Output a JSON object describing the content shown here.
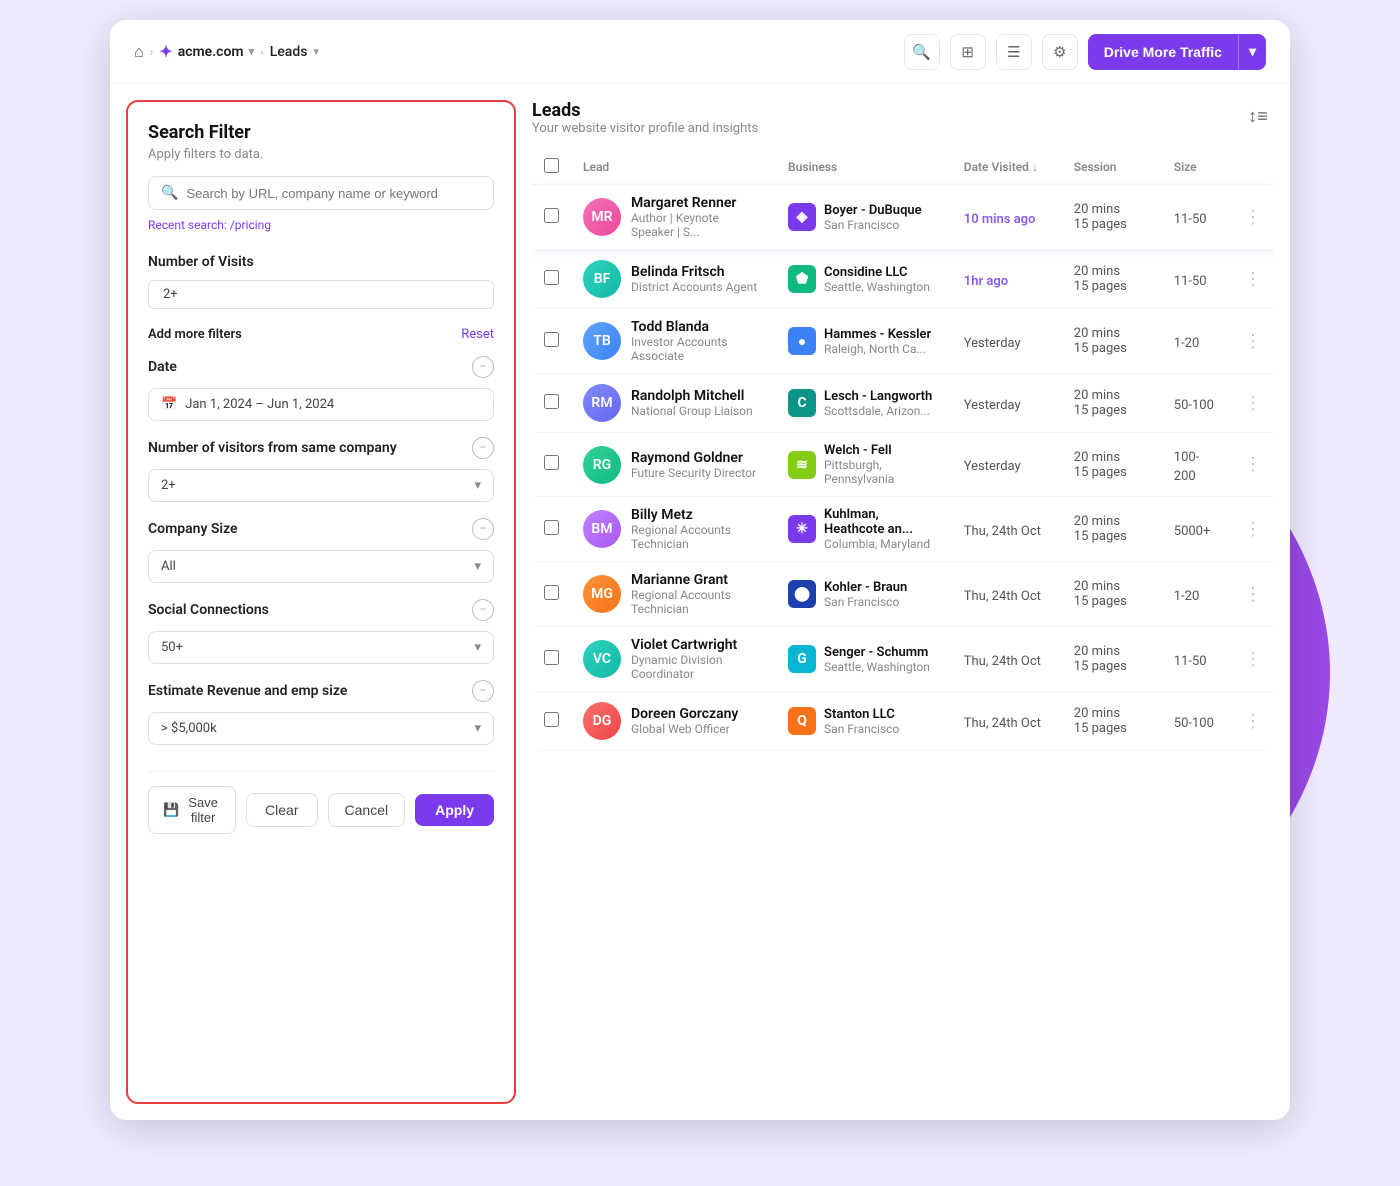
{
  "nav": {
    "home_icon": "⌂",
    "brand_star": "✦",
    "brand_name": "acme.com",
    "sep1": "›",
    "sep2": "›",
    "page_name": "Leads",
    "chevron": "▾",
    "drive_btn_label": "Drive More Traffic",
    "drive_btn_arrow": "▾"
  },
  "filter": {
    "title": "Search Filter",
    "subtitle": "Apply filters to data.",
    "search_placeholder": "Search by URL, company name or keyword",
    "recent_label": "Recent search:",
    "recent_value": "/pricing",
    "visits_label": "Number of Visits",
    "visits_value": "2+",
    "add_more_label": "Add more filters",
    "reset_label": "Reset",
    "date_label": "Date",
    "date_value": "Jan 1, 2024 – Jun 1, 2024",
    "visitors_label": "Number of visitors from same company",
    "visitors_value": "2+",
    "company_size_label": "Company Size",
    "company_size_value": "All",
    "social_label": "Social Connections",
    "social_value": "50+",
    "revenue_label": "Estimate Revenue and emp size",
    "revenue_value": "> $5,000k",
    "save_btn": "Save filter",
    "clear_btn": "Clear",
    "cancel_btn": "Cancel",
    "apply_btn": "Apply"
  },
  "leads": {
    "title": "Leads",
    "subtitle": "Your website visitor profile and insights",
    "columns": {
      "lead": "Lead",
      "business": "Business",
      "date_visited": "Date Visited",
      "session": "Session",
      "size": "Size"
    },
    "rows": [
      {
        "name": "Margaret Renner",
        "title_role": "Author | Keynote Speaker | S...",
        "business": "Boyer - DuBuque",
        "location": "San Francisco",
        "date": "10 mins ago",
        "date_hot": true,
        "session_time": "20 mins",
        "session_pages": "15 pages",
        "size": "11-50",
        "avatar_class": "av-pink",
        "avatar_initials": "MR",
        "biz_class": "bl-purple",
        "biz_icon": "◈"
      },
      {
        "name": "Belinda Fritsch",
        "title_role": "District Accounts Agent",
        "business": "Considine LLC",
        "location": "Seattle, Washington",
        "date": "1hr ago",
        "date_hot": true,
        "session_time": "20 mins",
        "session_pages": "15 pages",
        "size": "11-50",
        "avatar_class": "av-teal",
        "avatar_initials": "BF",
        "biz_class": "bl-green",
        "biz_icon": "⬟"
      },
      {
        "name": "Todd Blanda",
        "title_role": "Investor Accounts Associate",
        "business": "Hammes - Kessler",
        "location": "Raleigh, North Ca...",
        "date": "Yesterday",
        "date_hot": false,
        "session_time": "20 mins",
        "session_pages": "15 pages",
        "size": "1-20",
        "avatar_class": "av-blue",
        "avatar_initials": "TB",
        "biz_class": "bl-blue",
        "biz_icon": "●"
      },
      {
        "name": "Randolph Mitchell",
        "title_role": "National Group Liaison",
        "business": "Lesch - Langworth",
        "location": "Scottsdale, Arizon...",
        "date": "Yesterday",
        "date_hot": false,
        "session_time": "20 mins",
        "session_pages": "15 pages",
        "size": "50-100",
        "avatar_class": "av-indigo",
        "avatar_initials": "RM",
        "biz_class": "bl-teal",
        "biz_icon": "C"
      },
      {
        "name": "Raymond Goldner",
        "title_role": "Future Security Director",
        "business": "Welch - Fell",
        "location": "Pittsburgh, Pennsylvania",
        "date": "Yesterday",
        "date_hot": false,
        "session_time": "20 mins",
        "session_pages": "15 pages",
        "size": "100-200",
        "avatar_class": "av-green",
        "avatar_initials": "RG",
        "biz_class": "bl-lime",
        "biz_icon": "≋"
      },
      {
        "name": "Billy Metz",
        "title_role": "Regional Accounts Technician",
        "business": "Kuhlman, Heathcote an...",
        "location": "Columbia, Maryland",
        "date": "Thu, 24th Oct",
        "date_hot": false,
        "session_time": "20 mins",
        "session_pages": "15 pages",
        "size": "5000+",
        "avatar_class": "av-purple",
        "avatar_initials": "BM",
        "biz_class": "bl-purple",
        "biz_icon": "✳"
      },
      {
        "name": "Marianne Grant",
        "title_role": "Regional Accounts Technician",
        "business": "Kohler - Braun",
        "location": "San Francisco",
        "date": "Thu, 24th Oct",
        "date_hot": false,
        "session_time": "20 mins",
        "session_pages": "15 pages",
        "size": "1-20",
        "avatar_class": "av-orange",
        "avatar_initials": "MG",
        "biz_class": "bl-darkblue",
        "biz_icon": "⬤"
      },
      {
        "name": "Violet Cartwright",
        "title_role": "Dynamic Division Coordinator",
        "business": "Senger - Schumm",
        "location": "Seattle, Washington",
        "date": "Thu, 24th Oct",
        "date_hot": false,
        "session_time": "20 mins",
        "session_pages": "15 pages",
        "size": "11-50",
        "avatar_class": "av-teal",
        "avatar_initials": "VC",
        "biz_class": "bl-cyan",
        "biz_icon": "G"
      },
      {
        "name": "Doreen Gorczany",
        "title_role": "Global Web Officer",
        "business": "Stanton LLC",
        "location": "San Francisco",
        "date": "Thu, 24th Oct",
        "date_hot": false,
        "session_time": "20 mins",
        "session_pages": "15 pages",
        "size": "50-100",
        "avatar_class": "av-red",
        "avatar_initials": "DG",
        "biz_class": "bl-orange",
        "biz_icon": "Q"
      }
    ]
  }
}
